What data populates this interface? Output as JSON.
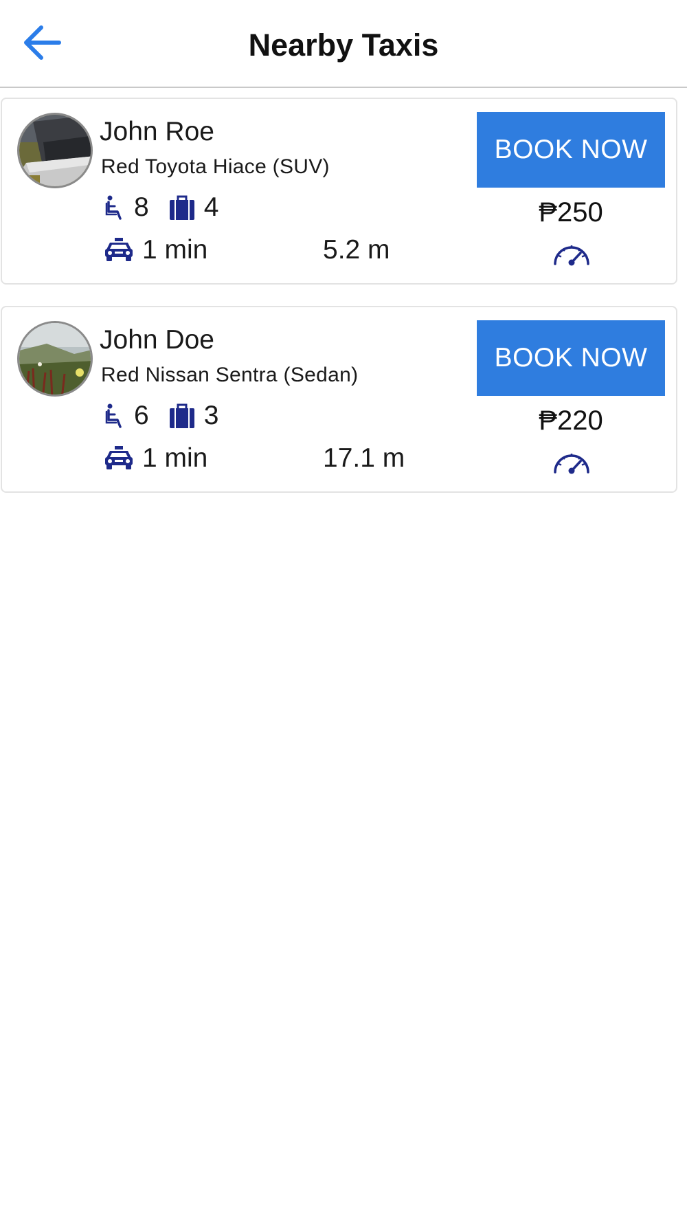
{
  "header": {
    "title": "Nearby Taxis",
    "back_icon": "arrow-left-icon"
  },
  "colors": {
    "accent": "#2f7ddf",
    "icon": "#1e2a8a",
    "back_arrow": "#2b7de9"
  },
  "taxis": [
    {
      "driver": "John Roe",
      "vehicle": "Red Toyota Hiace (SUV)",
      "seats": "8",
      "luggage": "4",
      "eta": "1 min",
      "distance": "5.2 m",
      "book_label": "BOOK NOW",
      "price": "₱250"
    },
    {
      "driver": "John Doe",
      "vehicle": "Red Nissan Sentra (Sedan)",
      "seats": "6",
      "luggage": "3",
      "eta": "1 min",
      "distance": "17.1 m",
      "book_label": "BOOK NOW",
      "price": "₱220"
    }
  ]
}
